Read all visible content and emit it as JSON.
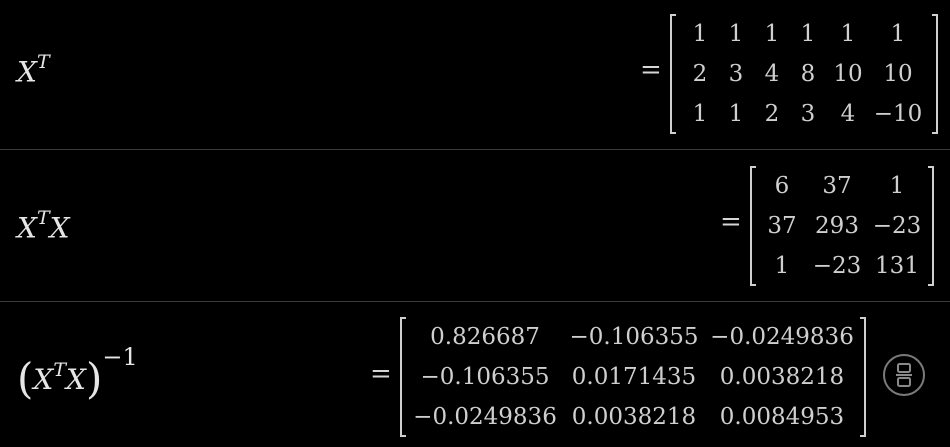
{
  "expressions": [
    {
      "label": {
        "base": "X",
        "sup": "T",
        "tail": "",
        "inverse": ""
      },
      "equals": "=",
      "matrix": [
        [
          "1",
          "1",
          "1",
          "1",
          "1",
          "1"
        ],
        [
          "2",
          "3",
          "4",
          "8",
          "10",
          "10"
        ],
        [
          "1",
          "1",
          "2",
          "3",
          "4",
          "−10"
        ]
      ]
    },
    {
      "label": {
        "base": "X",
        "sup": "T",
        "tail": "X",
        "inverse": ""
      },
      "equals": "=",
      "matrix": [
        [
          "6",
          "37",
          "1"
        ],
        [
          "37",
          "293",
          "−23"
        ],
        [
          "1",
          "−23",
          "131"
        ]
      ]
    },
    {
      "label": {
        "open": "(",
        "base": "X",
        "sup": "T",
        "tail": "X",
        "close": ")",
        "inverse": "−1"
      },
      "equals": "=",
      "matrix": [
        [
          "0.826687",
          "−0.106355",
          "−0.0249836"
        ],
        [
          "−0.106355",
          "0.0171435",
          "0.0038218"
        ],
        [
          "−0.0249836",
          "0.0038218",
          "0.0084953"
        ]
      ]
    }
  ],
  "icons": {
    "collapse_button": "fraction-toggle-icon"
  }
}
